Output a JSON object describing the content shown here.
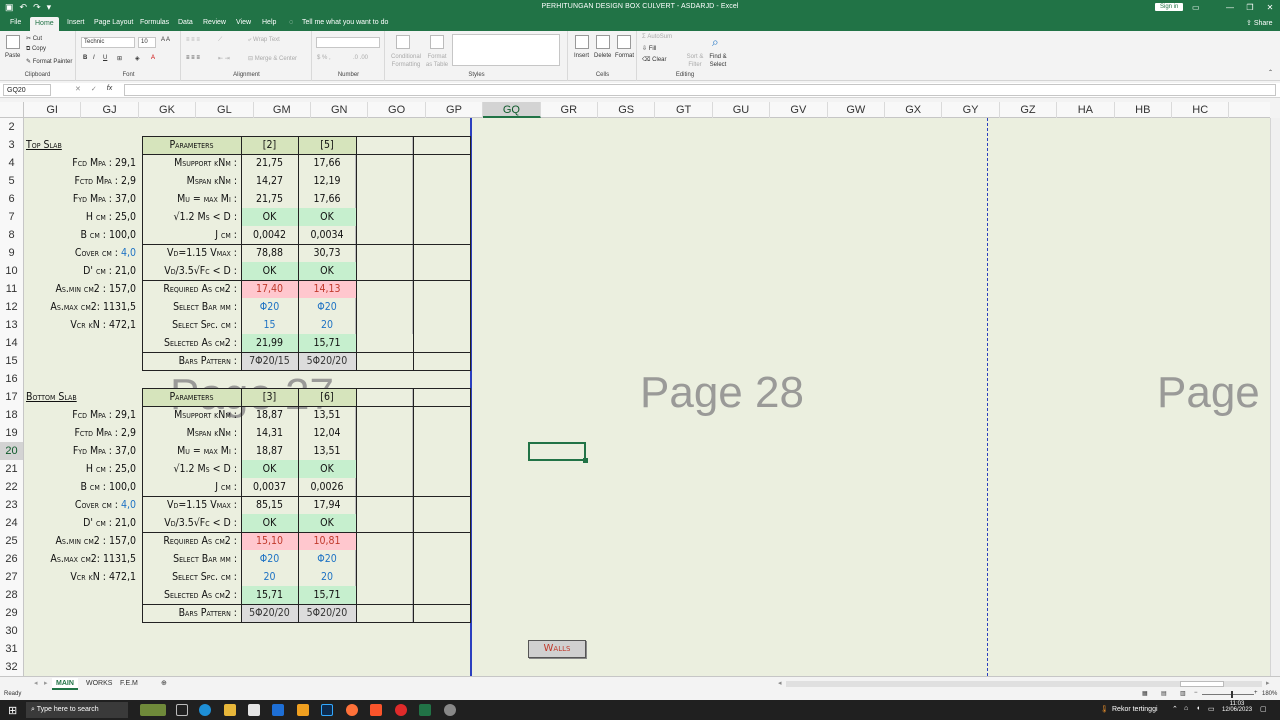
{
  "window": {
    "title": "PERHITUNGAN DESIGN BOX CULVERT - ASDARJD  -  Excel",
    "sign_in": "Sign in"
  },
  "tabs": [
    "File",
    "Home",
    "Insert",
    "Page Layout",
    "Formulas",
    "Data",
    "Review",
    "View",
    "Help"
  ],
  "tell_me": "Tell me what you want to do",
  "share": "Share",
  "ribbon": {
    "clipboard": {
      "label": "Clipboard",
      "paste": "Paste",
      "cut": "Cut",
      "copy": "Copy",
      "format_painter": "Format Painter"
    },
    "font": {
      "label": "Font",
      "name": "Technic",
      "size": "10"
    },
    "alignment": {
      "label": "Alignment",
      "wrap": "Wrap Text",
      "merge": "Merge & Center"
    },
    "number": {
      "label": "Number"
    },
    "styles": {
      "label": "Styles",
      "cond": "Conditional Formatting",
      "fmt_table": "Format as Table"
    },
    "cells": {
      "label": "Cells",
      "insert": "Insert",
      "delete": "Delete",
      "format": "Format"
    },
    "editing": {
      "label": "Editing",
      "autosum": "AutoSum",
      "fill": "Fill",
      "clear": "Clear",
      "sort": "Sort & Filter",
      "find": "Find & Select"
    }
  },
  "formula_bar": {
    "name_box": "GQ20",
    "formula": ""
  },
  "columns": [
    "GI",
    "GJ",
    "GK",
    "GL",
    "GM",
    "GN",
    "GO",
    "GP",
    "GQ",
    "GR",
    "GS",
    "GT",
    "GU",
    "GV",
    "GW",
    "GX",
    "GY",
    "GZ",
    "HA",
    "HB",
    "HC"
  ],
  "selected_column": "GQ",
  "rows": [
    "2",
    "3",
    "4",
    "5",
    "6",
    "7",
    "8",
    "9",
    "10",
    "11",
    "12",
    "13",
    "14",
    "15",
    "16",
    "17",
    "18",
    "19",
    "20",
    "21",
    "22",
    "23",
    "24",
    "25",
    "26",
    "27",
    "28",
    "29",
    "30",
    "31",
    "32"
  ],
  "selected_row": "20",
  "watermarks": {
    "p27": "Page 27",
    "p28": "Page 28",
    "p29": "Page"
  },
  "top_slab": {
    "title": "Top Slab",
    "left": [
      [
        "Fcd Mpa : ",
        "29,1"
      ],
      [
        "Fctd Mpa : ",
        "2,9"
      ],
      [
        "Fyd Mpa : ",
        "37,0"
      ],
      [
        "H cm : ",
        "25,0"
      ],
      [
        "B cm : ",
        "100,0"
      ],
      [
        "Cover cm : ",
        "4,0"
      ],
      [
        "D' cm : ",
        "21,0"
      ],
      [
        "As.min cm2 : ",
        "157,0"
      ],
      [
        "As.max cm2: ",
        "1131,5"
      ],
      [
        "Vcr kN : ",
        "472,1"
      ]
    ],
    "header": [
      "Parameters",
      "[2]",
      "[5]"
    ],
    "rows": [
      [
        "Msupport kNm :",
        "21,75",
        "17,66"
      ],
      [
        "Mspan kNm :",
        "14,27",
        "12,19"
      ],
      [
        "Mu = max Mi :",
        "21,75",
        "17,66"
      ],
      [
        "√1.2 Ms < D :",
        "OK",
        "OK"
      ],
      [
        "J cm :",
        "0,0042",
        "0,0034"
      ],
      [
        "Vd=1.15 Vmax :",
        "78,88",
        "30,73"
      ],
      [
        "Vd/3.5√Fc < D :",
        "OK",
        "OK"
      ],
      [
        "Required As cm2 :",
        "17,40",
        "14,13"
      ],
      [
        "Select Bar mm :",
        "Φ20",
        "Φ20"
      ],
      [
        "Select Spc. cm :",
        "15",
        "20"
      ],
      [
        "Selected As cm2 :",
        "21,99",
        "15,71"
      ],
      [
        "Bars Pattern :",
        "7Φ20/15",
        "5Φ20/20"
      ]
    ]
  },
  "bottom_slab": {
    "title": "Bottom Slab",
    "left": [
      [
        "Fcd Mpa : ",
        "29,1"
      ],
      [
        "Fctd Mpa : ",
        "2,9"
      ],
      [
        "Fyd Mpa : ",
        "37,0"
      ],
      [
        "H cm : ",
        "25,0"
      ],
      [
        "B cm : ",
        "100,0"
      ],
      [
        "Cover cm : ",
        "4,0"
      ],
      [
        "D' cm : ",
        "21,0"
      ],
      [
        "As.min cm2 : ",
        "157,0"
      ],
      [
        "As.max cm2: ",
        "1131,5"
      ],
      [
        "Vcr kN : ",
        "472,1"
      ]
    ],
    "header": [
      "Parameters",
      "[3]",
      "[6]"
    ],
    "rows": [
      [
        "Msupport kNm :",
        "18,87",
        "13,51"
      ],
      [
        "Mspan kNm :",
        "14,31",
        "12,04"
      ],
      [
        "Mu = max Mi :",
        "18,87",
        "13,51"
      ],
      [
        "√1.2 Ms < D :",
        "OK",
        "OK"
      ],
      [
        "J cm :",
        "0,0037",
        "0,0026"
      ],
      [
        "Vd=1.15 Vmax :",
        "85,15",
        "17,94"
      ],
      [
        "Vd/3.5√Fc < D :",
        "OK",
        "OK"
      ],
      [
        "Required As cm2 :",
        "15,10",
        "10,81"
      ],
      [
        "Select Bar mm :",
        "Φ20",
        "Φ20"
      ],
      [
        "Select Spc. cm :",
        "20",
        "20"
      ],
      [
        "Selected As cm2 :",
        "15,71",
        "15,71"
      ],
      [
        "Bars Pattern :",
        "5Φ20/20",
        "5Φ20/20"
      ]
    ]
  },
  "walls_button": "Walls",
  "sheet_tabs": [
    "MAIN",
    "WORKS",
    "F.E.M"
  ],
  "status": {
    "ready": "Ready",
    "zoom": "180%"
  },
  "taskbar": {
    "search": "Type here to search",
    "weather": "Rekor tertinggi",
    "time": "11:03",
    "date": "12/06/2023"
  },
  "colors": {
    "excel_green": "#217346",
    "sheet_bg": "#ebefdf",
    "ok_green": "#c6efce",
    "warn_red": "#ffc7ce",
    "header_olive": "#d6e4bc",
    "input_blue": "#1f73c4"
  }
}
